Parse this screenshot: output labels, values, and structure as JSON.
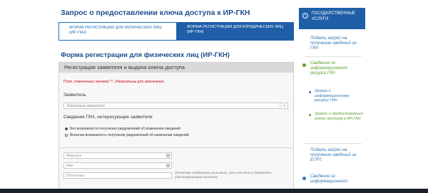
{
  "main": {
    "title": "Запрос о предоставлении ключа доступа к ИР-ГКН",
    "tabs": [
      {
        "label": "ФОРМА РЕГИСТРАЦИИ ДЛЯ ФИЗИЧЕСКИХ ЛИЦ (ИР-ГКН)",
        "active": true
      },
      {
        "label": "ФОРМА РЕГИСТРАЦИИ ДЛЯ ЮРИДИЧЕСКИХ ЛИЦ (ИР-ГКН)",
        "active": false
      }
    ],
    "section_title": "Форма регистрации для физических лиц (ИР-ГКН)",
    "panel": {
      "heading": "Регистрация заявителя и выдача ключа доступа",
      "required_note": "Поля, отмеченные значком \"!\", обязательны для заполнения",
      "applicant_label": "Заявитель",
      "applicant_placeholder": "Категория заявителя",
      "gkn_label": "Сведения ГКН, интересующие заявителя",
      "radio_options": [
        {
          "label": "Без возможности получения уведомлений об изменении сведений",
          "checked": true
        },
        {
          "label": "Включая возможность получения уведомлений об изменении сведений",
          "checked": false
        }
      ],
      "fields": {
        "surname": "Фамилия",
        "name": "Имя",
        "patronymic": "Отчество"
      },
      "patronymic_note": "Отчество необходимо указывать, если оно есть в документе, удостоверяющем личность."
    }
  },
  "sidebar": {
    "header": "ГОСУДАРСТВЕННЫЕ УСЛУГИ",
    "items": [
      "Подать запрос на получение сведений из ГКН",
      "Сведения из информационного ресурса ГКН",
      "Запрос к информационному ресурсу ГКН",
      "Запрос о предоставлении ключа доступа к ИР-ГКН",
      "Подать запрос на получение сведений из ЕГРП",
      "Сведения из информационного"
    ]
  }
}
